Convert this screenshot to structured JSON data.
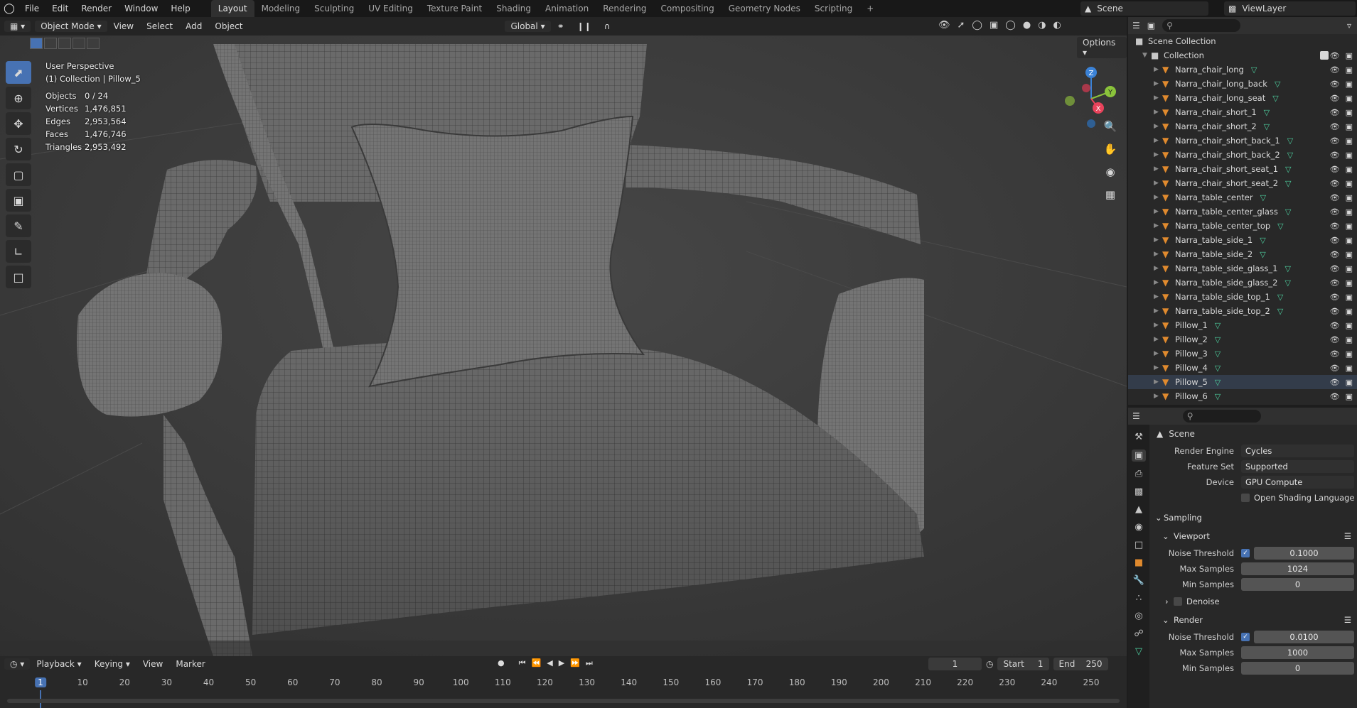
{
  "menu": [
    "File",
    "Edit",
    "Render",
    "Window",
    "Help"
  ],
  "workspaces": [
    "Layout",
    "Modeling",
    "Sculpting",
    "UV Editing",
    "Texture Paint",
    "Shading",
    "Animation",
    "Rendering",
    "Compositing",
    "Geometry Nodes",
    "Scripting"
  ],
  "active_workspace": "Layout",
  "scene_name": "Scene",
  "view_layer": "ViewLayer",
  "viewport": {
    "mode": "Object Mode",
    "menus": [
      "View",
      "Select",
      "Add",
      "Object"
    ],
    "transform_orientation": "Global",
    "options_label": "Options",
    "perspective_label": "User Perspective",
    "collection_label": "(1) Collection | Pillow_5",
    "stats": [
      {
        "key": "Objects",
        "value": "0 / 24"
      },
      {
        "key": "Vertices",
        "value": "1,476,851"
      },
      {
        "key": "Edges",
        "value": "2,953,564"
      },
      {
        "key": "Faces",
        "value": "1,476,746"
      },
      {
        "key": "Triangles",
        "value": "2,953,492"
      }
    ],
    "gizmo_axes": {
      "x": "X",
      "y": "Y",
      "z": "Z"
    }
  },
  "outliner": {
    "scene_collection": "Scene Collection",
    "collection": "Collection",
    "items": [
      "Narra_chair_long",
      "Narra_chair_long_back",
      "Narra_chair_long_seat",
      "Narra_chair_short_1",
      "Narra_chair_short_2",
      "Narra_chair_short_back_1",
      "Narra_chair_short_back_2",
      "Narra_chair_short_seat_1",
      "Narra_chair_short_seat_2",
      "Narra_table_center",
      "Narra_table_center_glass",
      "Narra_table_center_top",
      "Narra_table_side_1",
      "Narra_table_side_2",
      "Narra_table_side_glass_1",
      "Narra_table_side_glass_2",
      "Narra_table_side_top_1",
      "Narra_table_side_top_2",
      "Pillow_1",
      "Pillow_2",
      "Pillow_3",
      "Pillow_4",
      "Pillow_5",
      "Pillow_6"
    ],
    "selected": "Pillow_5"
  },
  "properties": {
    "title": "Scene",
    "render_engine_label": "Render Engine",
    "render_engine": "Cycles",
    "feature_set_label": "Feature Set",
    "feature_set": "Supported",
    "device_label": "Device",
    "device": "GPU Compute",
    "osl_label": "Open Shading Language",
    "sampling_label": "Sampling",
    "viewport_label": "Viewport",
    "render_label": "Render",
    "denoise_label": "Denoise",
    "noise_threshold_label": "Noise Threshold",
    "max_samples_label": "Max Samples",
    "min_samples_label": "Min Samples",
    "viewport_noise_threshold": "0.1000",
    "viewport_max_samples": "1024",
    "viewport_min_samples": "0",
    "render_noise_threshold": "0.0100",
    "render_max_samples": "1000",
    "render_min_samples": "0"
  },
  "timeline": {
    "menus": [
      "Playback",
      "Keying",
      "View",
      "Marker"
    ],
    "current_frame": "1",
    "start_label": "Start",
    "start": "1",
    "end_label": "End",
    "end": "250",
    "ruler": [
      "1",
      "10",
      "20",
      "30",
      "40",
      "50",
      "60",
      "70",
      "80",
      "90",
      "100",
      "110",
      "120",
      "130",
      "140",
      "150",
      "160",
      "170",
      "180",
      "190",
      "200",
      "210",
      "220",
      "230",
      "240",
      "250"
    ]
  },
  "colors": {
    "accent": "#4772b3",
    "object_icon": "#e08a2e",
    "mesh_icon": "#4ed1a0",
    "axis_x": "#e8435b",
    "axis_y": "#8ac33b",
    "axis_z": "#3b82d6"
  }
}
